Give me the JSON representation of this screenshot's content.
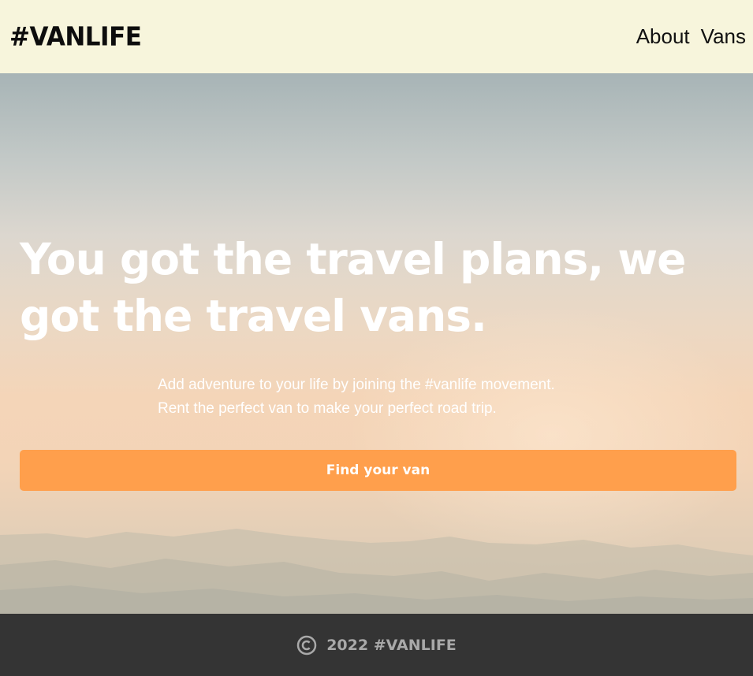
{
  "header": {
    "logo": "#VANLIFE",
    "nav": [
      {
        "label": "About"
      },
      {
        "label": "Vans"
      }
    ]
  },
  "hero": {
    "title": "You got the travel plans, we got the travel vans.",
    "subtitle_line1": "Add adventure to your life by joining the #vanlife movement.",
    "subtitle_line2": "Rent the perfect van to make your perfect road trip.",
    "cta_label": "Find your van"
  },
  "footer": {
    "icon": "copyright-icon",
    "text": "2022 #VANLIFE"
  },
  "colors": {
    "header_bg": "#f7f5dc",
    "cta_bg": "#ff9f4c",
    "footer_bg": "#343434",
    "footer_text": "#a9a9a9"
  }
}
